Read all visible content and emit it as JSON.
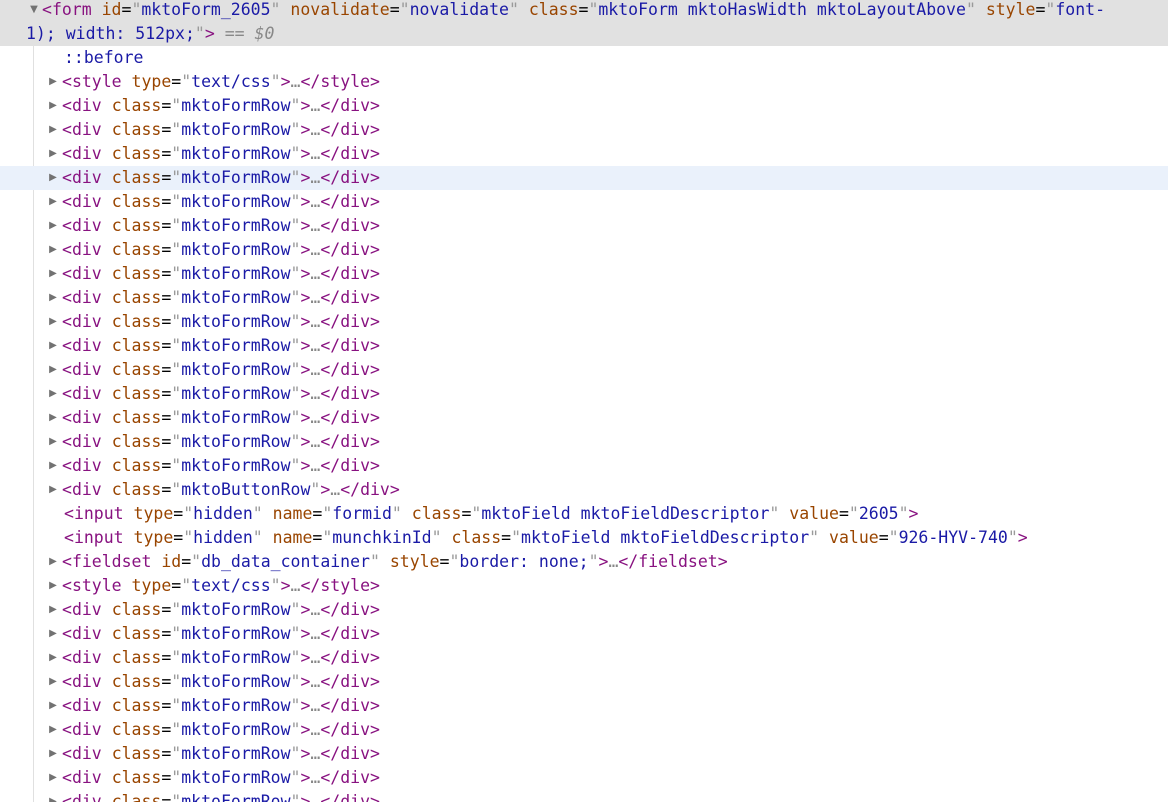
{
  "form": {
    "open_tag": "form",
    "attr_id_name": "id",
    "attr_id_value": "mktoForm_2605",
    "attr_novalidate_name": "novalidate",
    "attr_novalidate_value": "novalidate",
    "attr_class_name": "class",
    "attr_class_value": "mktoForm mktoHasWidth mktoLayoutAbove",
    "attr_style_name": "style",
    "attr_style_value_start": "font-",
    "attr_style_value_end": "1); width: 512px;",
    "selected_marker": "== $0"
  },
  "pseudo_before": "::before",
  "tags": {
    "style": "style",
    "div": "div",
    "input": "input",
    "fieldset": "fieldset",
    "type_attr": "type",
    "class_attr": "class",
    "name_attr": "name",
    "value_attr": "value",
    "id_attr": "id",
    "style_attr": "style",
    "style_type_value": "text/css",
    "form_row_class": "mktoFormRow",
    "button_row_class": "mktoButtonRow",
    "ellipsis": "…"
  },
  "hidden_inputs": [
    {
      "type": "hidden",
      "name": "formid",
      "class": "mktoField mktoFieldDescriptor",
      "value": "2605"
    },
    {
      "type": "hidden",
      "name": "munchkinId",
      "class": "mktoField mktoFieldDescriptor",
      "value": "926-HYV-740"
    }
  ],
  "fieldset": {
    "id": "db_data_container",
    "style": "border: none;"
  }
}
